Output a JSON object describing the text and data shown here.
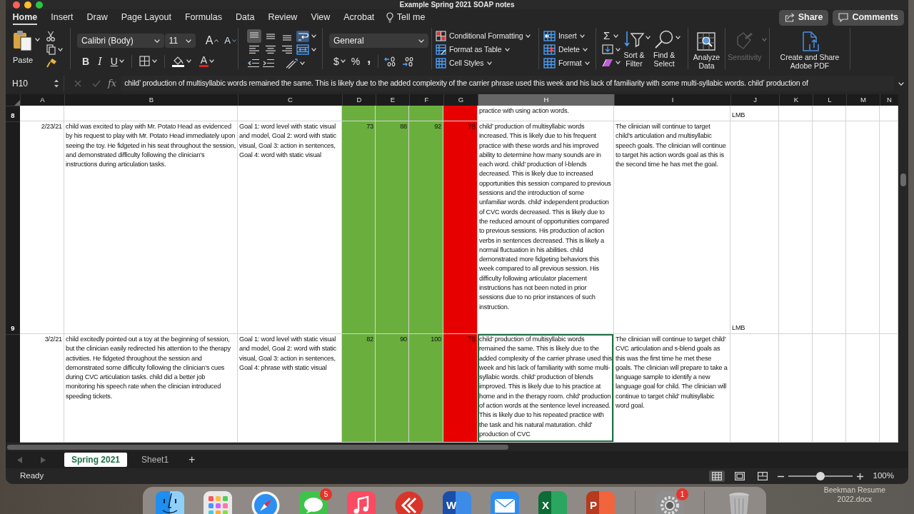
{
  "window": {
    "title": "Example Spring 2021 SOAP notes"
  },
  "ribbon_tabs": [
    {
      "label": "Home",
      "selected": true
    },
    {
      "label": "Insert",
      "selected": false
    },
    {
      "label": "Draw",
      "selected": false
    },
    {
      "label": "Page Layout",
      "selected": false
    },
    {
      "label": "Formulas",
      "selected": false
    },
    {
      "label": "Data",
      "selected": false
    },
    {
      "label": "Review",
      "selected": false
    },
    {
      "label": "View",
      "selected": false
    },
    {
      "label": "Acrobat",
      "selected": false
    }
  ],
  "tell_me": "Tell me",
  "header_buttons": [
    {
      "kind": "share",
      "label": "Share"
    },
    {
      "kind": "comments",
      "label": "Comments"
    }
  ],
  "ribbon": {
    "paste": {
      "label": "Paste"
    },
    "font": {
      "name": "Calibri (Body)",
      "size": "11",
      "grow": "A",
      "shrink": "A",
      "bold": "B",
      "italic": "I",
      "underline": "U",
      "font_color": "A"
    },
    "alignment": {
      "vertical": [
        {
          "kind": "top",
          "selected": true
        },
        {
          "kind": "middle",
          "selected": false
        },
        {
          "kind": "bottom",
          "selected": false
        }
      ],
      "horizontal": [
        {
          "kind": "left",
          "selected": false
        },
        {
          "kind": "center",
          "selected": false
        },
        {
          "kind": "right",
          "selected": false
        }
      ]
    },
    "number": {
      "format": "General",
      "currency": "$",
      "percent": "%",
      "comma": ","
    },
    "styles": [
      {
        "kind": "conditional",
        "label": "Conditional Formatting"
      },
      {
        "kind": "table",
        "label": "Format as Table"
      },
      {
        "kind": "cell",
        "label": "Cell Styles"
      }
    ],
    "cells": [
      {
        "kind": "insert",
        "label": "Insert"
      },
      {
        "kind": "delete",
        "label": "Delete"
      },
      {
        "kind": "format",
        "label": "Format"
      }
    ],
    "editing": {
      "sum": "Σ",
      "buttons": [
        {
          "kind": "sort",
          "lines": [
            "Sort &",
            "Filter"
          ]
        },
        {
          "kind": "find",
          "lines": [
            "Find &",
            "Select"
          ]
        }
      ]
    },
    "tools": [
      {
        "kind": "analyze",
        "lines": [
          "Analyze",
          "Data"
        ],
        "disabled": false
      },
      {
        "kind": "sensitivity",
        "lines": [
          "Sensitivity"
        ],
        "disabled": true
      },
      {
        "kind": "pdf",
        "lines": [
          "Create and Share",
          "Adobe PDF"
        ],
        "disabled": false
      }
    ]
  },
  "formula_bar": {
    "name_box": "H10",
    "cancel": {
      "disabled": true
    },
    "enter": {
      "disabled": true
    },
    "function_label": "fx",
    "formula": "child’ production of multisyllabic words remained the same. This is likely due to the added complexity of the carrier phrase used this week and his lack of familiarity with some multi-syllabic words. child’ production of"
  },
  "columns": [
    {
      "label": "A",
      "selected": false
    },
    {
      "label": "B",
      "selected": false
    },
    {
      "label": "C",
      "selected": false
    },
    {
      "label": "D",
      "selected": false
    },
    {
      "label": "E",
      "selected": false
    },
    {
      "label": "F",
      "selected": false
    },
    {
      "label": "G",
      "selected": false
    },
    {
      "label": "H",
      "selected": true
    },
    {
      "label": "I",
      "selected": false
    },
    {
      "label": "J",
      "selected": false
    },
    {
      "label": "K",
      "selected": false
    },
    {
      "label": "L",
      "selected": false
    },
    {
      "label": "M",
      "selected": false
    },
    {
      "label": "N",
      "selected": false
    }
  ],
  "rows": [
    {
      "number": "8",
      "cells": [
        {
          "selected": false
        },
        {
          "selected": false
        },
        {
          "selected": false
        },
        {
          "selected": false,
          "color": "#6aaf3e"
        },
        {
          "selected": false,
          "color": "#6aaf3e"
        },
        {
          "selected": false,
          "color": "#6aaf3e"
        },
        {
          "selected": false,
          "color": "#e60000"
        },
        {
          "selected": false,
          "text": "practice with using action words."
        },
        {
          "selected": false
        },
        {
          "selected": false,
          "text": "LMB"
        },
        {
          "selected": false
        },
        {
          "selected": false
        },
        {
          "selected": false
        },
        {
          "selected": false
        }
      ]
    },
    {
      "number": "9",
      "cells": [
        {
          "selected": false,
          "text": "2/23/21"
        },
        {
          "selected": false,
          "text": "child was excited to play with Mr. Potato Head as evidenced by his request to play with Mr. Potato Head immediately upon seeing the toy. He fidgeted in his seat throughout the session, and demonstrated difficulty following the clinician’s instructions during articulation tasks."
        },
        {
          "selected": false,
          "text": "Goal 1: word level with static visual and model, Goal 2: word with static visual, Goal 3: action in sentences, Goal 4: word with static visual"
        },
        {
          "selected": false,
          "text": "73",
          "color": "#6aaf3e"
        },
        {
          "selected": false,
          "text": "88",
          "color": "#6aaf3e"
        },
        {
          "selected": false,
          "text": "92",
          "color": "#6aaf3e"
        },
        {
          "selected": false,
          "text": "78",
          "color": "#e60000",
          "font": {
            "color": "#7a0000"
          }
        },
        {
          "selected": false,
          "text": "child’ production of multisyllabic words increased. This is likely due to his frequent practice with these words and his improved ability to determine how many sounds are in each word. child’ production of l-blends decreased. This is likely due to increased opportunities this session compared to previous sessions and the introduction of some unfamiliar words. child’ independent production of CVC words decreased. This is likely due to the reduced amount of opportunities compared to previous sessions. His production of action verbs in sentences decreased. This is likely a normal fluctuation in his abilities. child demonstrated more fidgeting behaviors this week compared to all previous session. His difficulty following articulator placement instructions has not been noted in prior sessions due to no prior instances of such instruction."
        },
        {
          "selected": false,
          "text": "The clinician will continue to target child’s articulation and multisyllabic speech goals. The clinician will continue to target his action words goal as this is the second time he has met the goal."
        },
        {
          "selected": false,
          "text": "LMB"
        },
        {
          "selected": false
        },
        {
          "selected": false
        },
        {
          "selected": false
        },
        {
          "selected": false
        }
      ]
    },
    {
      "cells": [
        {
          "selected": false,
          "text": "3/2/21"
        },
        {
          "selected": false,
          "text": "child excitedly pointed out a toy at the beginning of session, but the clinician easily redirected his attention to the therapy activities. He fidgeted throughout the session and demonstrated some difficulty following the clinician’s cues during CVC articulation tasks. child did a better job monitoring his speech rate when the clinician introduced speeding tickets."
        },
        {
          "selected": false,
          "text": "Goal 1: word level with static visual and model, Goal 2: word with static visual, Goal 3: action in sentences, Goal 4: phrase with static visual"
        },
        {
          "selected": false,
          "text": "82",
          "color": "#6aaf3e"
        },
        {
          "selected": false,
          "text": "90",
          "color": "#6aaf3e"
        },
        {
          "selected": false,
          "text": "100",
          "color": "#6aaf3e"
        },
        {
          "selected": false,
          "text": "78",
          "color": "#e60000",
          "font": {
            "color": "#7a0000"
          }
        },
        {
          "selected": true,
          "text": "child’ production of multisyllabic words remained the same. This is likely due to the added complexity of the carrier phrase used this week and his lack of familiarity with some multi-syllabic words. child’ production of blends improved. This is likely due to his practice at home and in the therapy room. child’ production of action words at the sentence level increased. This is likely due to his repeated practice with the task and his natural maturation. child’ production of CVC"
        },
        {
          "selected": false,
          "text": "The clinician will continue to target child’ CVC articulation and s-blend goals as this was the first time he met these goals. The clinician will prepare to take a language sample to identify a new language goal for child. The clinician will continue to target child’ multisyllabic word goal."
        },
        {
          "selected": false
        },
        {
          "selected": false
        },
        {
          "selected": false
        },
        {
          "selected": false
        },
        {
          "selected": false
        }
      ]
    }
  ],
  "sheet_tabs": [
    {
      "label": "Spring 2021",
      "selected": true
    },
    {
      "label": "Sheet1",
      "selected": false
    }
  ],
  "add_sheet": "+",
  "status_bar": {
    "status": "Ready",
    "views": [
      {
        "kind": "normal",
        "selected": true
      },
      {
        "kind": "page_layout",
        "selected": false
      },
      {
        "kind": "page_break",
        "selected": false
      }
    ],
    "zoom": {
      "level": 0.5,
      "label": "100%"
    }
  },
  "dock": [
    {
      "kind": "finder"
    },
    {
      "kind": "launchpad"
    },
    {
      "kind": "safari"
    },
    {
      "kind": "messages",
      "badge": "5"
    },
    {
      "kind": "music"
    },
    {
      "kind": "remote"
    },
    {
      "kind": "word",
      "letter": "W"
    },
    {
      "kind": "mail"
    },
    {
      "kind": "excel",
      "letter": "X"
    },
    {
      "kind": "powerpoint",
      "letter": "P"
    },
    {
      "kind": "separator"
    },
    {
      "kind": "settings",
      "badge": "1"
    },
    {
      "kind": "separator"
    },
    {
      "kind": "trash"
    }
  ],
  "desktop_files": [
    {
      "lines": [
        "Beekman Resume",
        "2022.docx"
      ]
    }
  ]
}
